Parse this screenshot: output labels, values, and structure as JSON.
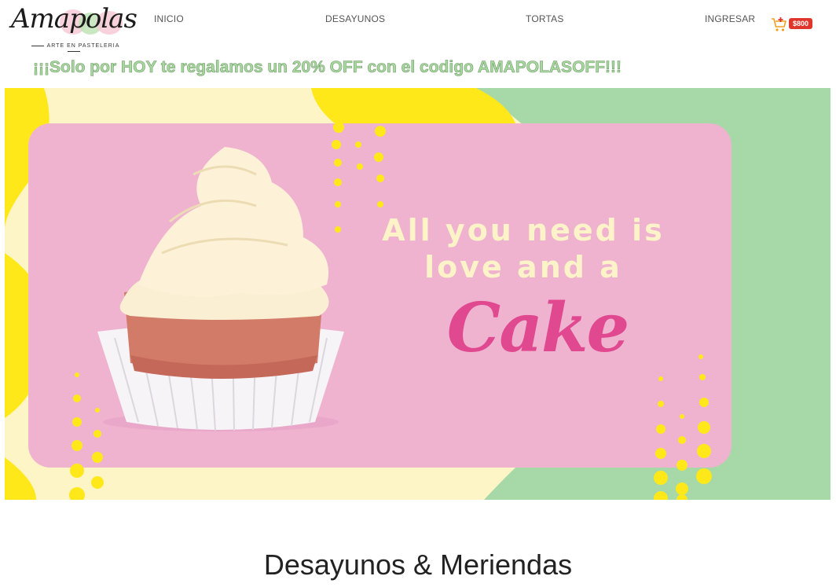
{
  "brand": {
    "name": "Amapolas",
    "tagline": "ARTE EN PASTELERIA"
  },
  "nav": {
    "items": [
      {
        "label": "INICIO"
      },
      {
        "label": "DESAYUNOS"
      },
      {
        "label": "TORTAS"
      },
      {
        "label": "INGRESAR"
      }
    ],
    "cart_total": "$800",
    "cart_icon": "cart-plus-icon"
  },
  "promo": {
    "text": "¡¡¡Solo por HOY te regalamos un 20% OFF con el codigo AMAPOLASOFF!!!"
  },
  "banner": {
    "line1": "All you need is",
    "line2": "love and a",
    "word": "Cake"
  },
  "section": {
    "title": "Desayunos & Meriendas"
  },
  "colors": {
    "promo_text": "#a8d8a0",
    "banner_pink": "#efb3d0",
    "banner_green": "#a6d8a8",
    "banner_yellow": "#ffe81a",
    "banner_cream": "#fdf5c6",
    "cake_word": "#e0488f",
    "cart_badge": "#e0352b"
  }
}
